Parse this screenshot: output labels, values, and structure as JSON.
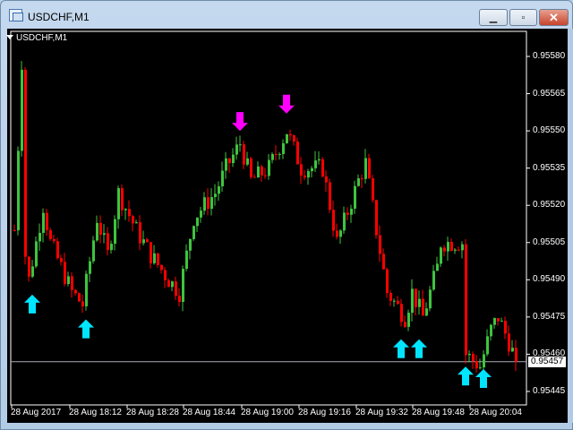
{
  "window": {
    "title": "USDCHF,M1",
    "minimize": "▁",
    "maximize": "▫",
    "close": "✕"
  },
  "chart": {
    "symbol_label": "USDCHF,M1",
    "current_price": "0.95457",
    "colors": {
      "bull": "#3ec43e",
      "bear": "#ff0000",
      "buy_arrow": "#00e5ff",
      "sell_arrow": "#ff00ff",
      "grid": "#ffffff"
    }
  },
  "chart_data": {
    "type": "candlestick",
    "price_ticks": [
      "0.95580",
      "0.95565",
      "0.95550",
      "0.95535",
      "0.95520",
      "0.95505",
      "0.95490",
      "0.95475",
      "0.95460",
      "0.95445"
    ],
    "time_ticks": [
      "28 Aug 2017",
      "28 Aug 18:12",
      "28 Aug 18:28",
      "28 Aug 18:44",
      "28 Aug 19:00",
      "28 Aug 19:16",
      "28 Aug 19:32",
      "28 Aug 19:48",
      "28 Aug 20:04"
    ],
    "ylim": [
      0.95438,
      0.95592
    ],
    "close_path": [
      [
        0,
        0.9551
      ],
      [
        2,
        0.95578
      ],
      [
        3,
        0.955
      ],
      [
        4,
        0.9549
      ],
      [
        8,
        0.9552
      ],
      [
        10,
        0.95505
      ],
      [
        16,
        0.95485
      ],
      [
        19,
        0.9548
      ],
      [
        23,
        0.95515
      ],
      [
        26,
        0.955
      ],
      [
        29,
        0.95525
      ],
      [
        34,
        0.9551
      ],
      [
        38,
        0.955
      ],
      [
        43,
        0.9549
      ],
      [
        46,
        0.95485
      ],
      [
        50,
        0.95515
      ],
      [
        56,
        0.95525
      ],
      [
        59,
        0.95535
      ],
      [
        63,
        0.95545
      ],
      [
        66,
        0.9553
      ],
      [
        71,
        0.95535
      ],
      [
        76,
        0.9555
      ],
      [
        80,
        0.95535
      ],
      [
        86,
        0.95535
      ],
      [
        90,
        0.95505
      ],
      [
        96,
        0.9553
      ],
      [
        98,
        0.95537
      ],
      [
        101,
        0.9551
      ],
      [
        104,
        0.95485
      ],
      [
        109,
        0.95475
      ],
      [
        111,
        0.95485
      ],
      [
        114,
        0.95475
      ],
      [
        118,
        0.95495
      ],
      [
        119,
        0.95505
      ],
      [
        125,
        0.95505
      ],
      [
        126,
        0.9546
      ],
      [
        130,
        0.95455
      ],
      [
        133,
        0.9547
      ],
      [
        135,
        0.95475
      ],
      [
        138,
        0.95465
      ],
      [
        140,
        0.95457
      ]
    ],
    "buy_signals": [
      [
        5,
        0.95484
      ],
      [
        20,
        0.95474
      ],
      [
        108,
        0.95466
      ],
      [
        113,
        0.95466
      ],
      [
        126,
        0.95455
      ],
      [
        131,
        0.95454
      ]
    ],
    "sell_signals": [
      [
        63,
        0.9555
      ],
      [
        76,
        0.95557
      ]
    ]
  }
}
